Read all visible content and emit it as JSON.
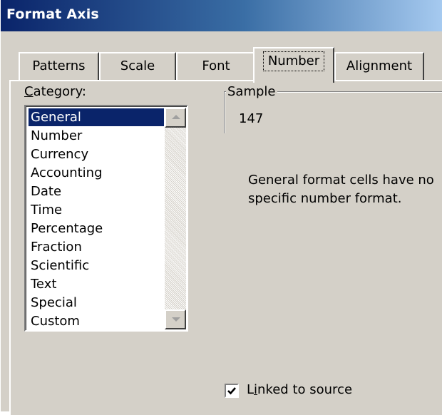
{
  "window": {
    "title": "Format Axis"
  },
  "tabs": [
    {
      "label": "Patterns",
      "active": false
    },
    {
      "label": "Scale",
      "active": false
    },
    {
      "label": "Font",
      "active": false
    },
    {
      "label": "Number",
      "active": true
    },
    {
      "label": "Alignment",
      "active": false
    }
  ],
  "category": {
    "label_accel": "C",
    "label_rest": "ategory:",
    "selected": "General",
    "items": [
      "General",
      "Number",
      "Currency",
      "Accounting",
      "Date",
      "Time",
      "Percentage",
      "Fraction",
      "Scientific",
      "Text",
      "Special",
      "Custom"
    ]
  },
  "sample": {
    "legend": "Sample",
    "value": "147"
  },
  "description": {
    "line1": "General format cells have no",
    "line2": "specific number format."
  },
  "linked": {
    "checked": true,
    "label_pre": "L",
    "label_accel": "i",
    "label_post": "nked to source"
  },
  "colors": {
    "selection": "#0a246a",
    "dialog_face": "#d4d0c8",
    "title_gradient_start": "#0a246a"
  }
}
